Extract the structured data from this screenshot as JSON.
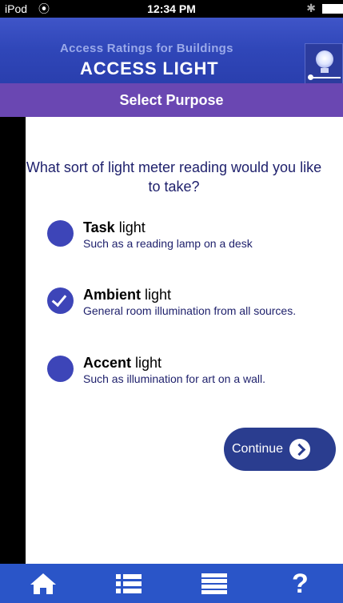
{
  "status": {
    "carrier": "iPod",
    "time": "12:34 PM"
  },
  "header": {
    "subtitle": "Access Ratings for Buildings",
    "title": "ACCESS LIGHT",
    "logo": "light-meter-logo-icon"
  },
  "purpose_bar": {
    "label": "Select Purpose"
  },
  "question": "What sort of light meter reading would you like to take?",
  "options": [
    {
      "bold": "Task",
      "rest": " light",
      "desc": "Such as a reading lamp on a desk",
      "selected": false
    },
    {
      "bold": "Ambient",
      "rest": " light",
      "desc": "General room illumination from all sources.",
      "selected": true
    },
    {
      "bold": "Accent",
      "rest": " light",
      "desc": "Such as illumination for art on a wall.",
      "selected": false
    }
  ],
  "continue_button": {
    "label": "Continue"
  },
  "tab_bar": {
    "help_label": "?",
    "icons": [
      "home-icon",
      "list-icon",
      "menu-icon",
      "help-icon"
    ]
  },
  "colors": {
    "header_blue": "#2f46b8",
    "purpose_purple": "#6a47b2",
    "radio_blue": "#3d45b8",
    "button_navy": "#2a3d8f",
    "tab_blue": "#2a55c8"
  }
}
